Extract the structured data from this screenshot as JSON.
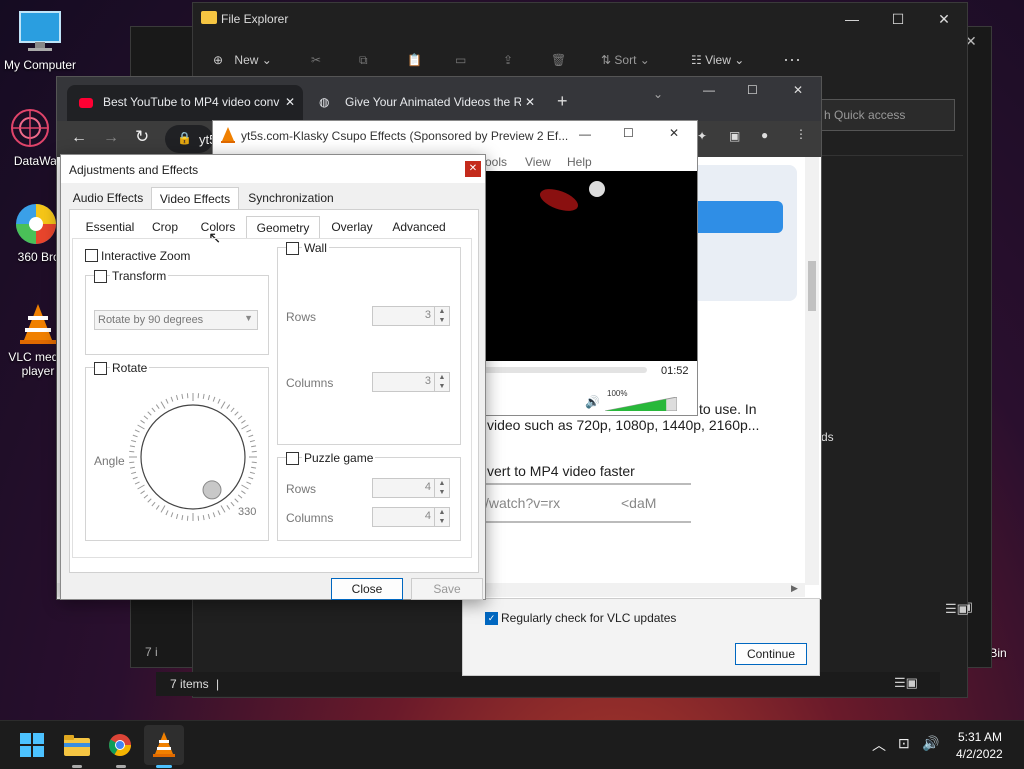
{
  "desktop": {
    "icons": [
      {
        "label": "My Computer"
      },
      {
        "label": "DataWago"
      },
      {
        "label": "360 Brows"
      },
      {
        "label": "VLC media player"
      },
      {
        "label": "Recycle Bin"
      }
    ]
  },
  "explorer": {
    "title": "File Explorer",
    "toolbar": {
      "new": "New",
      "sort": "Sort",
      "view": "View"
    },
    "search_placeholder": "h Quick access",
    "status": "7 items",
    "status_back": "7 i",
    "right_text": "ds"
  },
  "chrome": {
    "tabs": [
      {
        "label": "Best YouTube to MP4 video conv"
      },
      {
        "label": "Give Your Animated Videos the R"
      }
    ],
    "address": "yt5",
    "page": {
      "line1": "to use. In",
      "line2": "video such as 720p, 1080p, 1440p, 2160p...",
      "line3": "vert to MP4 video faster",
      "input_text": "/watch?v=rx",
      "input_right": "<daM"
    }
  },
  "vlc_window": {
    "title": "yt5s.com-Klasky Csupo Effects (Sponsored by Preview 2 Ef...",
    "menu": [
      "Tools",
      "View",
      "Help"
    ],
    "time": "01:52",
    "volume": "100%",
    "volume_level": 0.85,
    "update_check": "Regularly check for VLC updates",
    "continue": "Continue"
  },
  "dialog": {
    "title": "Adjustments and Effects",
    "top_tabs": [
      "Audio Effects",
      "Video Effects",
      "Synchronization"
    ],
    "sub_tabs": [
      "Essential",
      "Crop",
      "Colors",
      "Geometry",
      "Overlay",
      "Advanced"
    ],
    "interactive_zoom": "Interactive Zoom",
    "transform": "Transform",
    "rotate_select": "Rotate by 90 degrees",
    "rotate": "Rotate",
    "angle": "Angle",
    "angle_value": "330",
    "wall": "Wall",
    "rows": "Rows",
    "columns": "Columns",
    "wall_rows": "3",
    "wall_columns": "3",
    "puzzle": "Puzzle game",
    "puzzle_rows": "4",
    "puzzle_columns": "4",
    "close": "Close",
    "save": "Save"
  },
  "taskbar": {
    "time": "5:31 AM",
    "date": "4/2/2022"
  },
  "colors": {
    "accent": "#0067c0",
    "vlc_orange": "#f08000",
    "chrome_dark": "#35363a"
  }
}
